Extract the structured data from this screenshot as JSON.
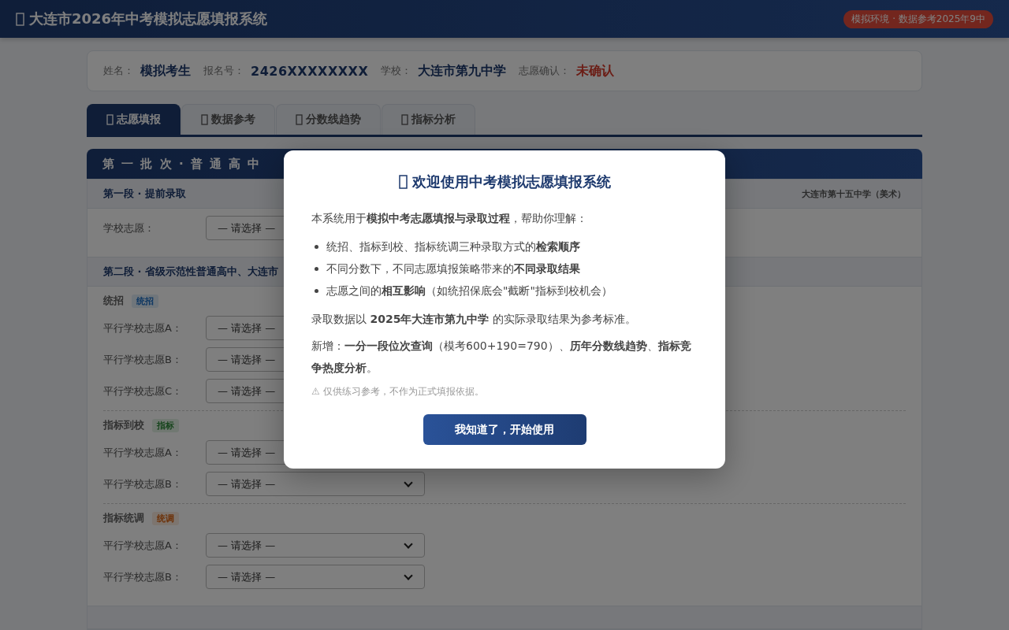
{
  "header": {
    "title": "大连市2026年中考模拟志愿填报系统",
    "env_badge": "模拟环境 · 数据参考2025年9中"
  },
  "info": [
    {
      "label": "姓名：",
      "value": "模拟考生",
      "kind": "text"
    },
    {
      "label": "报名号：",
      "value": "2426XXXXXXXX",
      "kind": "code"
    },
    {
      "label": "学校：",
      "value": "大连市第九中学",
      "kind": "text"
    },
    {
      "label": "志愿确认：",
      "value": "未确认",
      "kind": "status"
    }
  ],
  "tabs": [
    {
      "label": "志愿填报",
      "selected": true
    },
    {
      "label": "数据参考",
      "selected": false
    },
    {
      "label": "分数线趋势",
      "selected": false
    },
    {
      "label": "指标分析",
      "selected": false
    }
  ],
  "batch_title": "第 一 批 次 · 普 通 高 中",
  "stages": [
    {
      "title": "第一段 · 提前录取",
      "note": "大连市第十五中学（美术）",
      "groups": [
        {
          "choices": [
            {
              "label": "学校志愿：",
              "value": "— 请选择 —"
            }
          ]
        }
      ]
    },
    {
      "title": "第二段 · 省级示范性普通高中、大连市",
      "groups": [
        {
          "name": "统招",
          "tag": "统招",
          "kind": "unified",
          "choices": [
            {
              "label": "平行学校志愿A：",
              "value": "— 请选择 —"
            },
            {
              "label": "平行学校志愿B：",
              "value": "— 请选择 —"
            },
            {
              "label": "平行学校志愿C：",
              "value": "— 请选择 —"
            }
          ]
        },
        {
          "name": "指标到校",
          "tag": "指标",
          "kind": "quota",
          "choices": [
            {
              "label": "平行学校志愿A：",
              "value": "— 请选择 —"
            },
            {
              "label": "平行学校志愿B：",
              "value": "— 请选择 —"
            }
          ]
        },
        {
          "name": "指标统调",
          "tag": "统调",
          "kind": "adjust",
          "choices": [
            {
              "label": "平行学校志愿A：",
              "value": "— 请选择 —"
            },
            {
              "label": "平行学校志愿B：",
              "value": "— 请选择 —"
            }
          ]
        }
      ]
    },
    {
      "kind": "cut_off"
    }
  ],
  "modal": {
    "title": "欢迎使用中考模拟志愿填报系统",
    "intro": "本系统用于**模拟中考志愿填报与录取过程**，帮助你理解：",
    "bullets": [
      "统招、指标到校、指标统调三种录取方式的**检索顺序**",
      "不同分数下，不同志愿填报策略带来的**不同录取结果**",
      "志愿之间的**相互影响**（如统招保底会\"截断\"指标到校机会）"
    ],
    "paragraphs": [
      "录取数据以 **2025年大连市第九中学** 的实际录取结果为参考标准。",
      "新增：**一分一段位次查询**（模考600+190=790）、**历年分数线趋势**、**指标竞争热度分析**。"
    ],
    "warning": "⚠ 仅供练习参考，不作为正式填报依据。",
    "button": "我知道了，开始使用"
  }
}
